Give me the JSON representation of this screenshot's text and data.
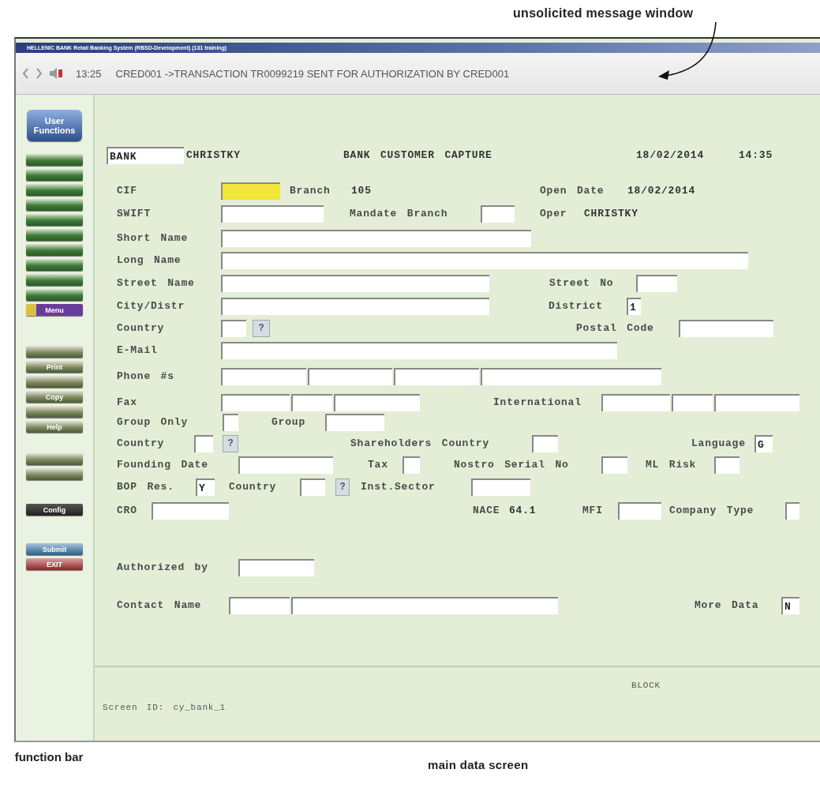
{
  "annotations": {
    "top": "unsolicited message window",
    "function_bar": "function bar",
    "main_screen": "main data screen"
  },
  "window": {
    "title": "HELLENIC BANK Retail Banking System (RBSD-Development) (131 training)"
  },
  "message_bar": {
    "time": "13:25",
    "message": "CRED001 ->TRANSACTION TR0099219 SENT FOR AUTHORIZATION BY CRED001"
  },
  "function_bar": {
    "groups": [
      [
        {
          "kind": "header",
          "label": "User Functions"
        }
      ],
      [
        {
          "kind": "green"
        },
        {
          "kind": "green"
        },
        {
          "kind": "green"
        },
        {
          "kind": "green"
        },
        {
          "kind": "green"
        },
        {
          "kind": "green"
        },
        {
          "kind": "green"
        },
        {
          "kind": "green"
        },
        {
          "kind": "green"
        },
        {
          "kind": "green"
        },
        {
          "kind": "menu",
          "label": "Menu"
        }
      ],
      [
        {
          "kind": "action"
        },
        {
          "kind": "action",
          "label": "Print"
        },
        {
          "kind": "action"
        },
        {
          "kind": "action",
          "label": "Copy"
        },
        {
          "kind": "action"
        },
        {
          "kind": "action",
          "label": "Help"
        }
      ],
      [
        {
          "kind": "action"
        },
        {
          "kind": "action"
        }
      ],
      [
        {
          "kind": "config",
          "label": "Config"
        }
      ],
      [
        {
          "kind": "submit",
          "label": "Submit"
        },
        {
          "kind": "exit",
          "label": "EXIT"
        }
      ]
    ]
  },
  "form": {
    "rows": [
      {
        "items": [
          {
            "kind": "field",
            "value": "BANK"
          },
          {
            "kind": "text",
            "text": "CHRISTKY"
          },
          {
            "kind": "text",
            "text": "BANK CUSTOMER CAPTURE"
          },
          {
            "kind": "text",
            "text": "18/02/2014"
          },
          {
            "kind": "text",
            "text": "14:35"
          }
        ]
      },
      {
        "items": [
          {
            "kind": "label",
            "text": "CIF"
          },
          {
            "kind": "field",
            "focused": true
          },
          {
            "kind": "label",
            "text": "Branch"
          },
          {
            "kind": "text",
            "text": "105"
          },
          {
            "kind": "label",
            "text": "Open Date"
          },
          {
            "kind": "text",
            "text": "18/02/2014"
          }
        ]
      },
      {
        "items": [
          {
            "kind": "label",
            "text": "SWIFT"
          },
          {
            "kind": "field",
            "focused": false
          },
          {
            "kind": "label",
            "text": "Mandate Branch"
          },
          {
            "kind": "field",
            "focused": false
          },
          {
            "kind": "label",
            "text": "Oper"
          },
          {
            "kind": "text",
            "text": "CHRISTKY"
          }
        ]
      },
      {
        "items": [
          {
            "kind": "label",
            "text": "Short Name"
          },
          {
            "kind": "field",
            "focused": false
          }
        ]
      },
      {
        "items": [
          {
            "kind": "label",
            "text": "Long Name"
          },
          {
            "kind": "field",
            "focused": false
          }
        ]
      },
      {
        "items": [
          {
            "kind": "label",
            "text": "Street Name"
          },
          {
            "kind": "field",
            "focused": false
          },
          {
            "kind": "label",
            "text": "Street No"
          },
          {
            "kind": "field",
            "focused": false
          }
        ]
      },
      {
        "items": [
          {
            "kind": "label",
            "text": "City/Distr"
          },
          {
            "kind": "field",
            "focused": false
          },
          {
            "kind": "label",
            "text": "District"
          },
          {
            "kind": "field",
            "focused": false,
            "value": "1"
          }
        ]
      },
      {
        "items": [
          {
            "kind": "label",
            "text": "Country"
          },
          {
            "kind": "field",
            "focused": false
          },
          {
            "kind": "lookup",
            "text": "?"
          },
          {
            "kind": "label",
            "text": "Postal Code"
          },
          {
            "kind": "field",
            "focused": false
          }
        ]
      },
      {
        "items": [
          {
            "kind": "label",
            "text": "E-Mail"
          },
          {
            "kind": "field",
            "focused": false
          }
        ]
      },
      {
        "items": [
          {
            "kind": "label",
            "text": "Phone #s"
          },
          {
            "kind": "field",
            "focused": false
          },
          {
            "kind": "field",
            "focused": false
          },
          {
            "kind": "field",
            "focused": false
          },
          {
            "kind": "field",
            "focused": false
          }
        ]
      },
      {
        "items": [
          {
            "kind": "label",
            "text": "Fax"
          },
          {
            "kind": "field",
            "focused": false
          },
          {
            "kind": "field",
            "focused": false
          },
          {
            "kind": "field",
            "focused": false
          },
          {
            "kind": "label",
            "text": "International"
          },
          {
            "kind": "field",
            "focused": false
          },
          {
            "kind": "field",
            "focused": false
          },
          {
            "kind": "field",
            "focused": false
          }
        ]
      },
      {
        "items": [
          {
            "kind": "label",
            "text": "Group Only"
          },
          {
            "kind": "field",
            "focused": false
          },
          {
            "kind": "label",
            "text": "Group"
          },
          {
            "kind": "field",
            "focused": false
          }
        ]
      },
      {
        "items": [
          {
            "kind": "label",
            "text": "Country"
          },
          {
            "kind": "field",
            "focused": false
          },
          {
            "kind": "lookup",
            "text": "?"
          },
          {
            "kind": "label",
            "text": "Shareholders Country"
          },
          {
            "kind": "field",
            "focused": false
          },
          {
            "kind": "label",
            "text": "Language"
          },
          {
            "kind": "field",
            "focused": false,
            "value": "G"
          }
        ]
      },
      {
        "items": [
          {
            "kind": "label",
            "text": "Founding Date"
          },
          {
            "kind": "field",
            "focused": false
          },
          {
            "kind": "label",
            "text": "Tax"
          },
          {
            "kind": "field",
            "focused": false
          },
          {
            "kind": "label",
            "text": "Nostro Serial No"
          },
          {
            "kind": "field",
            "focused": false
          },
          {
            "kind": "label",
            "text": "ML Risk"
          },
          {
            "kind": "field",
            "focused": false
          }
        ]
      },
      {
        "items": [
          {
            "kind": "label",
            "text": "BOP Res."
          },
          {
            "kind": "field",
            "focused": false,
            "value": "Y"
          },
          {
            "kind": "label",
            "text": "Country"
          },
          {
            "kind": "field",
            "focused": false
          },
          {
            "kind": "lookup",
            "text": "?"
          },
          {
            "kind": "label",
            "text": "Inst.Sector"
          },
          {
            "kind": "field",
            "focused": false
          }
        ]
      },
      {
        "items": [
          {
            "kind": "label",
            "text": "CRO"
          },
          {
            "kind": "field",
            "focused": false
          },
          {
            "kind": "label",
            "text": "NACE"
          },
          {
            "kind": "text",
            "text": "64.1"
          },
          {
            "kind": "label",
            "text": "MFI"
          },
          {
            "kind": "field",
            "focused": false
          },
          {
            "kind": "label",
            "text": "Company Type"
          },
          {
            "kind": "field",
            "focused": false
          }
        ]
      },
      {
        "items": [
          {
            "kind": "label",
            "text": "Authorized by"
          },
          {
            "kind": "field",
            "focused": false
          }
        ]
      },
      {
        "items": [
          {
            "kind": "label",
            "text": "Contact Name"
          },
          {
            "kind": "field",
            "focused": false
          },
          {
            "kind": "field",
            "focused": false
          },
          {
            "kind": "label",
            "text": "More Data"
          },
          {
            "kind": "field",
            "focused": false,
            "value": "N"
          }
        ]
      }
    ]
  },
  "footer": {
    "status": "BLOCK",
    "screen_id": "Screen ID: cy_bank_1"
  }
}
